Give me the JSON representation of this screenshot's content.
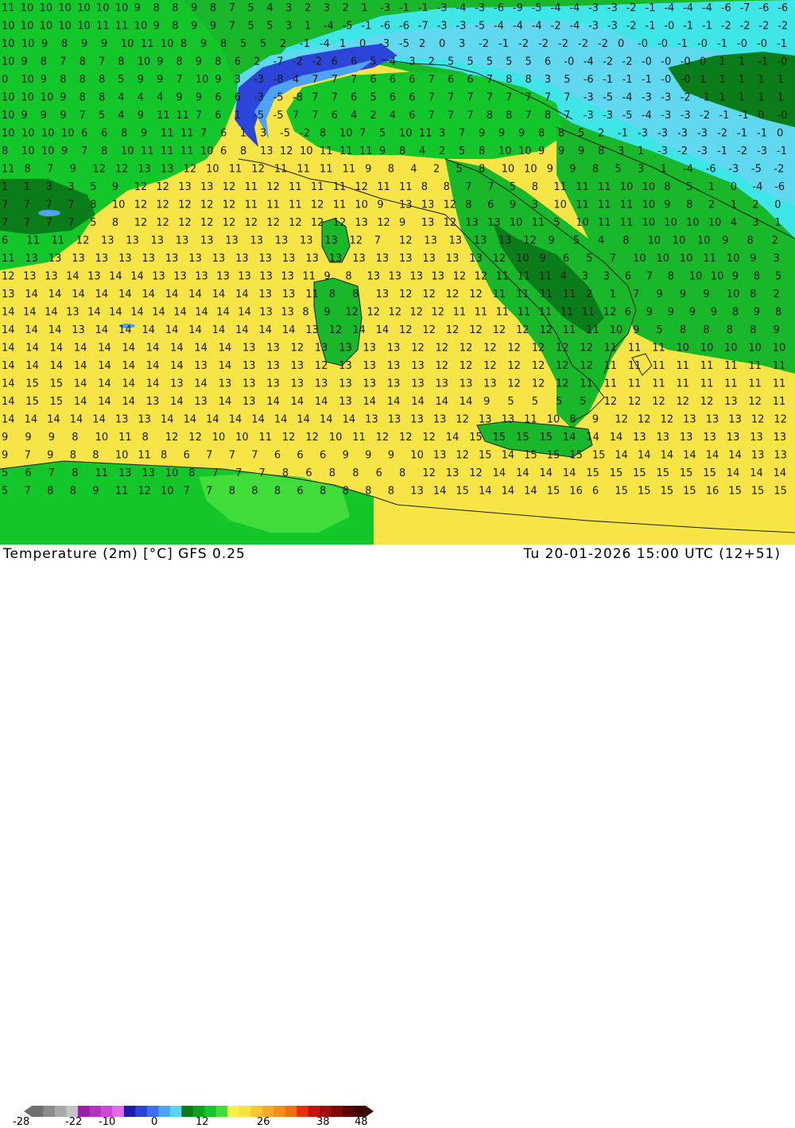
{
  "map": {
    "region": "Italy and central Mediterranean",
    "variable": "Temperature (2m)",
    "unit": "°C",
    "model": "GFS 0.25",
    "valid_time": "Tu 20-01-2026 15:00 UTC (12+51)"
  },
  "footer": {
    "title_left": "Temperature (2m) [°C] GFS 0.25",
    "title_right": "Tu 20-01-2026 15:00 UTC (12+51)"
  },
  "legend": {
    "ticks": [
      "-28",
      "-22",
      "-10",
      "0",
      "12",
      "26",
      "38",
      "48"
    ],
    "colors": [
      "#707070",
      "#8c8c8c",
      "#a8a8a8",
      "#c4c4c4",
      "#9a1fa6",
      "#b52fc2",
      "#cf47d9",
      "#e26be6",
      "#1c1caa",
      "#2c42d4",
      "#3b6ff0",
      "#4fa3f7",
      "#58d4f5",
      "#0b7a1a",
      "#0ea31e",
      "#13c72b",
      "#3fdc3a",
      "#f5f04a",
      "#f7e13d",
      "#f6c832",
      "#f5ab26",
      "#f28e1c",
      "#ef6f14",
      "#e8300f",
      "#c4120e",
      "#a00b0b",
      "#7e0808",
      "#5c0404",
      "#3f0202"
    ]
  },
  "colors": {
    "warm_sea": "#f7e547",
    "land_green": "#18b82a",
    "dark_green": "#0a7d1a",
    "cold_cyan": "#3ee6e8",
    "light_blue": "#1fb7f0",
    "deep_blue": "#2b45d8"
  },
  "values": [
    [
      "11",
      "10",
      "10",
      "10",
      "10",
      "10",
      "10",
      "9",
      "8",
      "8",
      "9",
      "8",
      "7",
      "5",
      "4",
      "3",
      "2",
      "3",
      "2",
      "1",
      "-3",
      "-1",
      "-1",
      "-3",
      "-4",
      "-3",
      "-6",
      "-9",
      "-5",
      "-4",
      "-4",
      "-3",
      "-3",
      "-2",
      "-1",
      "-4",
      "-4",
      "-4",
      "-6",
      "-7",
      "-6",
      "-6"
    ],
    [
      "10",
      "10",
      "10",
      "10",
      "10",
      "11",
      "11",
      "10",
      "9",
      "8",
      "9",
      "9",
      "7",
      "5",
      "5",
      "3",
      "1",
      "-4",
      "-5",
      "-1",
      "-6",
      "-6",
      "-7",
      "-3",
      "-3",
      "-5",
      "-4",
      "-4",
      "-4",
      "-2",
      "-4",
      "-3",
      "-3",
      "-2",
      "-1",
      "-0",
      "-1",
      "-1",
      "-2",
      "-2",
      "-2",
      "-2"
    ],
    [
      "10",
      "10",
      "9",
      "8",
      "9",
      "9",
      "10",
      "11",
      "10",
      "8",
      "9",
      "8",
      "5",
      "5",
      "2",
      "-1",
      "-4",
      "1",
      "0",
      "-3",
      "-5",
      "2",
      "0",
      "3",
      "-2",
      "-1",
      "-2",
      "-2",
      "-2",
      "-2",
      "-2",
      "0",
      "-0",
      "-0",
      "-1",
      "-0",
      "-1",
      "-0",
      "-0",
      "-1"
    ],
    [
      "10",
      "9",
      "8",
      "7",
      "8",
      "7",
      "8",
      "10",
      "9",
      "8",
      "9",
      "8",
      "6",
      "2",
      "-7",
      "-2",
      "-2",
      "6",
      "6",
      "5",
      "4",
      "3",
      "2",
      "5",
      "5",
      "5",
      "5",
      "5",
      "6",
      "-0",
      "-4",
      "-2",
      "-2",
      "-0",
      "-0",
      "-0",
      "0",
      "1",
      "1",
      "-1",
      "-0"
    ],
    [
      "0",
      "10",
      "9",
      "8",
      "8",
      "8",
      "5",
      "9",
      "9",
      "7",
      "10",
      "9",
      "3",
      "-3",
      "-8",
      "4",
      "7",
      "7",
      "7",
      "6",
      "6",
      "6",
      "7",
      "6",
      "6",
      "7",
      "8",
      "8",
      "3",
      "5",
      "-6",
      "-1",
      "-1",
      "-1",
      "-0",
      "-0",
      "1",
      "1",
      "1",
      "1",
      "1"
    ],
    [
      "10",
      "10",
      "10",
      "9",
      "8",
      "8",
      "4",
      "4",
      "4",
      "9",
      "9",
      "6",
      "6",
      "-3",
      "-5",
      "-8",
      "7",
      "7",
      "6",
      "5",
      "6",
      "6",
      "7",
      "7",
      "7",
      "7",
      "7",
      "7",
      "7",
      "7",
      "-3",
      "-5",
      "-4",
      "-3",
      "-3",
      "-2",
      "-1",
      "1",
      "1",
      "1",
      "1"
    ],
    [
      "10",
      "9",
      "9",
      "9",
      "7",
      "5",
      "4",
      "9",
      "11",
      "11",
      "7",
      "6",
      "1",
      "-5",
      "-5",
      "7",
      "7",
      "6",
      "4",
      "2",
      "4",
      "6",
      "7",
      "7",
      "7",
      "8",
      "8",
      "7",
      "8",
      "7",
      "-3",
      "-3",
      "-5",
      "-4",
      "-3",
      "-3",
      "-2",
      "-1",
      "-1",
      "0",
      "-0"
    ],
    [
      "10",
      "10",
      "10",
      "10",
      "6",
      "6",
      "8",
      "9",
      "11",
      "11",
      "7",
      "6",
      "1",
      "3",
      "-5",
      "-2",
      "8",
      "10",
      "7",
      "5",
      "10",
      "11",
      "3",
      "7",
      "9",
      "9",
      "9",
      "8",
      "8",
      "5",
      "2",
      "-1",
      "-3",
      "-3",
      "-3",
      "-3",
      "-2",
      "-1",
      "-1",
      "0"
    ],
    [
      "8",
      "10",
      "10",
      "9",
      "7",
      "8",
      "10",
      "11",
      "11",
      "11",
      "10",
      "6",
      "8",
      "13",
      "12",
      "10",
      "11",
      "11",
      "11",
      "9",
      "8",
      "4",
      "2",
      "5",
      "8",
      "10",
      "10",
      "9",
      "9",
      "9",
      "8",
      "3",
      "1",
      "-3",
      "-2",
      "-3",
      "-1",
      "-2",
      "-3",
      "-1"
    ],
    [
      "11",
      "8",
      "7",
      "9",
      "12",
      "12",
      "13",
      "13",
      "12",
      "10",
      "11",
      "12",
      "11",
      "11",
      "11",
      "11",
      "9",
      "8",
      "4",
      "2",
      "5",
      "8",
      "10",
      "10",
      "9",
      "9",
      "8",
      "5",
      "3",
      "1",
      "-4",
      "-6",
      "-3",
      "-5",
      "-2"
    ],
    [
      "1",
      "1",
      "3",
      "3",
      "5",
      "9",
      "12",
      "12",
      "13",
      "13",
      "12",
      "11",
      "12",
      "11",
      "11",
      "11",
      "12",
      "11",
      "11",
      "8",
      "8",
      "7",
      "7",
      "5",
      "8",
      "11",
      "11",
      "11",
      "10",
      "10",
      "8",
      "5",
      "1",
      "0",
      "-4",
      "-6"
    ],
    [
      "7",
      "7",
      "7",
      "7",
      "8",
      "10",
      "12",
      "12",
      "12",
      "12",
      "12",
      "11",
      "11",
      "11",
      "12",
      "11",
      "10",
      "9",
      "13",
      "13",
      "12",
      "8",
      "6",
      "9",
      "3",
      "10",
      "11",
      "11",
      "11",
      "10",
      "9",
      "8",
      "2",
      "1",
      "2",
      "0"
    ],
    [
      "7",
      "7",
      "7",
      "7",
      "5",
      "8",
      "12",
      "12",
      "12",
      "12",
      "12",
      "12",
      "12",
      "12",
      "12",
      "12",
      "13",
      "12",
      "9",
      "13",
      "12",
      "13",
      "13",
      "10",
      "11",
      "5",
      "10",
      "11",
      "11",
      "10",
      "10",
      "10",
      "10",
      "4",
      "3",
      "1"
    ],
    [
      "6",
      "11",
      "11",
      "12",
      "13",
      "13",
      "13",
      "13",
      "13",
      "13",
      "13",
      "13",
      "13",
      "13",
      "12",
      "7",
      "12",
      "13",
      "13",
      "13",
      "13",
      "12",
      "9",
      "5",
      "4",
      "8",
      "10",
      "10",
      "10",
      "9",
      "8",
      "2"
    ],
    [
      "11",
      "13",
      "13",
      "13",
      "13",
      "13",
      "13",
      "13",
      "13",
      "13",
      "13",
      "13",
      "13",
      "13",
      "13",
      "13",
      "13",
      "13",
      "13",
      "13",
      "13",
      "12",
      "10",
      "9",
      "6",
      "5",
      "7",
      "10",
      "10",
      "10",
      "11",
      "10",
      "9",
      "3"
    ],
    [
      "12",
      "13",
      "13",
      "14",
      "13",
      "14",
      "14",
      "13",
      "13",
      "13",
      "13",
      "13",
      "13",
      "13",
      "11",
      "9",
      "8",
      "13",
      "13",
      "13",
      "13",
      "12",
      "12",
      "11",
      "11",
      "11",
      "4",
      "3",
      "3",
      "6",
      "7",
      "8",
      "10",
      "10",
      "9",
      "8",
      "5"
    ],
    [
      "13",
      "14",
      "14",
      "14",
      "14",
      "14",
      "14",
      "14",
      "14",
      "14",
      "14",
      "13",
      "13",
      "11",
      "8",
      "8",
      "13",
      "12",
      "12",
      "12",
      "12",
      "11",
      "11",
      "11",
      "11",
      "2",
      "1",
      "7",
      "9",
      "9",
      "9",
      "10",
      "8",
      "2"
    ],
    [
      "14",
      "14",
      "14",
      "13",
      "14",
      "14",
      "14",
      "14",
      "14",
      "14",
      "14",
      "14",
      "13",
      "13",
      "8",
      "9",
      "12",
      "12",
      "12",
      "12",
      "12",
      "11",
      "11",
      "11",
      "11",
      "11",
      "11",
      "11",
      "12",
      "6",
      "9",
      "9",
      "9",
      "9",
      "8",
      "9",
      "8"
    ],
    [
      "14",
      "14",
      "14",
      "13",
      "14",
      "14",
      "14",
      "14",
      "14",
      "14",
      "14",
      "14",
      "14",
      "13",
      "12",
      "14",
      "14",
      "12",
      "12",
      "12",
      "12",
      "12",
      "12",
      "12",
      "11",
      "11",
      "10",
      "9",
      "5",
      "8",
      "8",
      "8",
      "8",
      "9"
    ],
    [
      "14",
      "14",
      "14",
      "14",
      "14",
      "14",
      "14",
      "14",
      "14",
      "14",
      "13",
      "13",
      "12",
      "13",
      "13",
      "13",
      "13",
      "12",
      "12",
      "12",
      "12",
      "12",
      "12",
      "12",
      "12",
      "11",
      "11",
      "11",
      "10",
      "10",
      "10",
      "10",
      "10"
    ],
    [
      "14",
      "14",
      "14",
      "14",
      "14",
      "14",
      "14",
      "14",
      "13",
      "14",
      "13",
      "13",
      "13",
      "12",
      "13",
      "13",
      "13",
      "13",
      "12",
      "12",
      "12",
      "12",
      "12",
      "12",
      "12",
      "11",
      "11",
      "11",
      "11",
      "11",
      "11",
      "11",
      "11"
    ],
    [
      "14",
      "15",
      "15",
      "14",
      "14",
      "14",
      "14",
      "13",
      "14",
      "13",
      "13",
      "13",
      "13",
      "13",
      "13",
      "13",
      "13",
      "13",
      "13",
      "13",
      "13",
      "12",
      "12",
      "12",
      "11",
      "11",
      "11",
      "11",
      "11",
      "11",
      "11",
      "11",
      "11"
    ],
    [
      "14",
      "15",
      "15",
      "14",
      "14",
      "14",
      "13",
      "14",
      "13",
      "14",
      "13",
      "14",
      "14",
      "14",
      "13",
      "14",
      "14",
      "14",
      "14",
      "14",
      "9",
      "5",
      "5",
      "5",
      "5",
      "12",
      "12",
      "12",
      "12",
      "12",
      "13",
      "12",
      "11"
    ],
    [
      "14",
      "14",
      "14",
      "14",
      "14",
      "13",
      "13",
      "14",
      "14",
      "14",
      "14",
      "14",
      "14",
      "14",
      "14",
      "14",
      "13",
      "13",
      "13",
      "13",
      "12",
      "13",
      "13",
      "11",
      "10",
      "8",
      "9",
      "12",
      "12",
      "12",
      "13",
      "13",
      "13",
      "12",
      "12"
    ],
    [
      "9",
      "9",
      "9",
      "8",
      "10",
      "11",
      "8",
      "12",
      "12",
      "10",
      "10",
      "11",
      "12",
      "12",
      "10",
      "11",
      "12",
      "12",
      "12",
      "14",
      "15",
      "15",
      "15",
      "15",
      "14",
      "14",
      "14",
      "13",
      "13",
      "13",
      "13",
      "13",
      "13",
      "13"
    ],
    [
      "9",
      "7",
      "9",
      "8",
      "8",
      "10",
      "11",
      "8",
      "6",
      "7",
      "7",
      "7",
      "6",
      "6",
      "6",
      "9",
      "9",
      "9",
      "10",
      "13",
      "12",
      "15",
      "14",
      "15",
      "15",
      "15",
      "15",
      "14",
      "14",
      "14",
      "14",
      "14",
      "14",
      "13",
      "13"
    ],
    [
      "5",
      "6",
      "7",
      "8",
      "11",
      "13",
      "13",
      "10",
      "8",
      "7",
      "7",
      "7",
      "8",
      "6",
      "8",
      "8",
      "6",
      "8",
      "12",
      "13",
      "12",
      "14",
      "14",
      "14",
      "14",
      "15",
      "15",
      "15",
      "15",
      "15",
      "15",
      "14",
      "14",
      "14"
    ],
    [
      "5",
      "7",
      "8",
      "8",
      "9",
      "11",
      "12",
      "10",
      "7",
      "7",
      "8",
      "8",
      "8",
      "6",
      "8",
      "8",
      "8",
      "8",
      "13",
      "14",
      "15",
      "14",
      "14",
      "14",
      "15",
      "16",
      "6",
      "15",
      "15",
      "15",
      "15",
      "16",
      "15",
      "15",
      "15"
    ]
  ]
}
